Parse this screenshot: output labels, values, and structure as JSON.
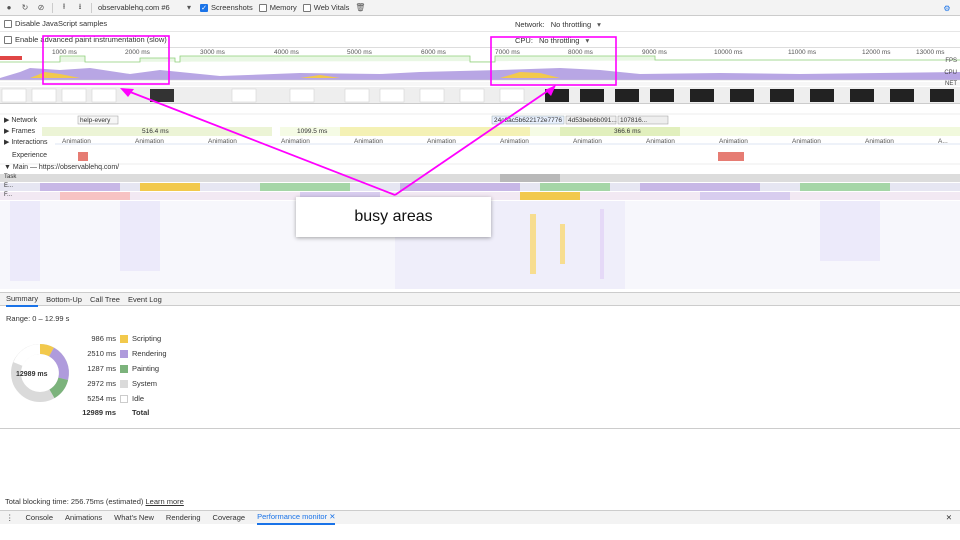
{
  "toolbar": {
    "session": "observablehq.com #6",
    "screenshots_label": "Screenshots",
    "memory_label": "Memory",
    "web_vitals_label": "Web Vitals"
  },
  "settings": {
    "disable_js_label": "Disable JavaScript samples",
    "advanced_paint_label": "Enable advanced paint instrumentation (slow)",
    "network_label": "Network:",
    "network_value": "No throttling",
    "cpu_label": "CPU:",
    "cpu_value": "No throttling"
  },
  "ruler": [
    "1000 ms",
    "2000 ms",
    "3000 ms",
    "4000 ms",
    "5000 ms",
    "6000 ms",
    "7000 ms",
    "8000 ms",
    "9000 ms",
    "10000 ms",
    "11000 ms",
    "12000 ms",
    "13000 ms"
  ],
  "overview_tracks": {
    "fps": "FPS",
    "cpu": "CPU",
    "net": "NET"
  },
  "timeline": {
    "network_label": "Network",
    "network_item_1": "help-every",
    "network_item_2": "24c8ac5b622172e7776",
    "network_item_3": "4d53beb6b091...",
    "network_item_4": "107816...",
    "frames_label": "Frames",
    "frame_1": "516.4 ms",
    "frame_2": "1099.5 ms",
    "frame_3": "366.6 ms",
    "interactions_label": "Interactions",
    "animation_label": "Animation",
    "animation_last": "A...",
    "experience_label": "Experience",
    "main_label": "Main — https://observablehq.com/",
    "task_label": "Task",
    "e_label": "E...",
    "f_label": "F..."
  },
  "tabs": [
    "Summary",
    "Bottom-Up",
    "Call Tree",
    "Event Log"
  ],
  "summary": {
    "range": "Range: 0 – 12.99 s",
    "total_center": "12989 ms",
    "rows": [
      {
        "ms": "986 ms",
        "label": "Scripting",
        "color": "#f2c94c"
      },
      {
        "ms": "2510 ms",
        "label": "Rendering",
        "color": "#af9bdc"
      },
      {
        "ms": "1287 ms",
        "label": "Painting",
        "color": "#7cb37c"
      },
      {
        "ms": "2972 ms",
        "label": "System",
        "color": "#dadada"
      },
      {
        "ms": "5254 ms",
        "label": "Idle",
        "color": "#ffffff"
      }
    ],
    "total_ms": "12989 ms",
    "total_label": "Total"
  },
  "footer": {
    "text": "Total blocking time: 256.75ms (estimated)",
    "link": "Learn more"
  },
  "drawer": [
    "Console",
    "Animations",
    "What's New",
    "Rendering",
    "Coverage",
    "Performance monitor"
  ],
  "annotation": "busy areas",
  "colors": {
    "highlight": "#ff00ff",
    "accent": "#1a73e8"
  }
}
